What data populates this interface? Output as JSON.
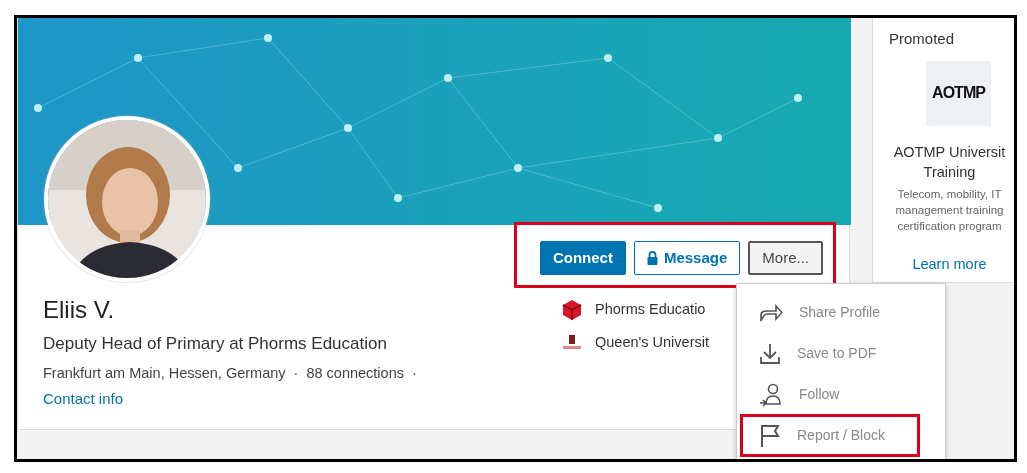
{
  "profile": {
    "name": "Eliis V.",
    "headline": "Deputy Head of Primary at Phorms Education",
    "meta": [
      "Frankfurt am Main, Hessen, Germany",
      "·",
      "88 connections",
      "·"
    ],
    "contact_link": "Contact info"
  },
  "actions": {
    "highlighted": true,
    "buttons": [
      {
        "label": "Connect",
        "kind": "primary"
      },
      {
        "label": "Message",
        "kind": "outline"
      },
      {
        "label": "More...",
        "kind": "secondary"
      }
    ]
  },
  "education": [
    {
      "name": "Phorms Educatio"
    },
    {
      "name": "Queen's Universit"
    }
  ],
  "more_menu": {
    "items": [
      {
        "label": "Share Profile",
        "highlighted": false
      },
      {
        "label": "Save to PDF",
        "highlighted": false
      },
      {
        "label": "Follow",
        "highlighted": false
      },
      {
        "label": "Report / Block",
        "highlighted": true
      }
    ]
  },
  "promoted": {
    "heading": "Promoted",
    "logo": "AOTMP",
    "title_lines": [
      "AOTMP Universit",
      "Training"
    ],
    "description": [
      "Telecom, mobility, IT",
      "management training",
      "certification program"
    ],
    "link": "Learn more"
  }
}
